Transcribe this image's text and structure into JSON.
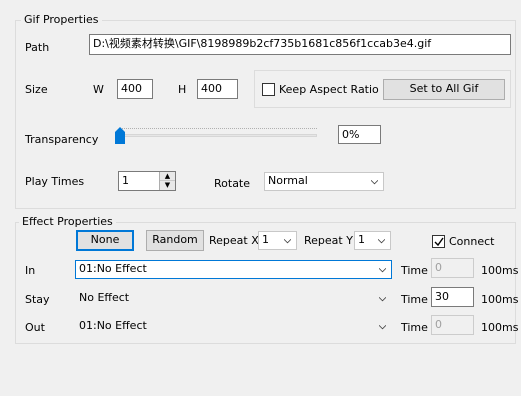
{
  "gif_properties": {
    "title": "Gif Properties",
    "path_label": "Path",
    "path_value": "D:\\视频素材转换\\GIF\\8198989b2cf735b1681c856f1ccab3e4.gif",
    "size_label": "Size",
    "w_label": "W",
    "w_value": "400",
    "h_label": "H",
    "h_value": "400",
    "keep_aspect_label": "Keep Aspect Ratio",
    "keep_aspect_checked": false,
    "set_all_label": "Set to All Gif",
    "transparency_label": "Transparency",
    "transparency_value": "0%",
    "transparency_fraction": 0,
    "play_times_label": "Play Times",
    "play_times_value": "1",
    "rotate_label": "Rotate",
    "rotate_value": "Normal"
  },
  "effect_properties": {
    "title": "Effect Properties",
    "none_label": "None",
    "random_label": "Random",
    "repeat_x_label": "Repeat X",
    "repeat_x_value": "1",
    "repeat_y_label": "Repeat Y",
    "repeat_y_value": "1",
    "connect_label": "Connect",
    "connect_checked": true,
    "time_label": "Time",
    "unit_label": "100ms",
    "rows": [
      {
        "label": "In",
        "effect": "01:No Effect",
        "time": "0",
        "time_enabled": false
      },
      {
        "label": "Stay",
        "effect": "No Effect",
        "time": "30",
        "time_enabled": true
      },
      {
        "label": "Out",
        "effect": "01:No Effect",
        "time": "0",
        "time_enabled": false
      }
    ]
  },
  "icons": {
    "chevron": "chevron-down-icon",
    "spin_up": "spin-up-icon",
    "spin_down": "spin-down-icon",
    "check": "checkmark-icon",
    "slider_thumb": "slider-thumb-icon"
  },
  "colors": {
    "accent": "#0078d7",
    "window_bg": "#f0f0f0",
    "button_bg": "#e1e1e1"
  }
}
